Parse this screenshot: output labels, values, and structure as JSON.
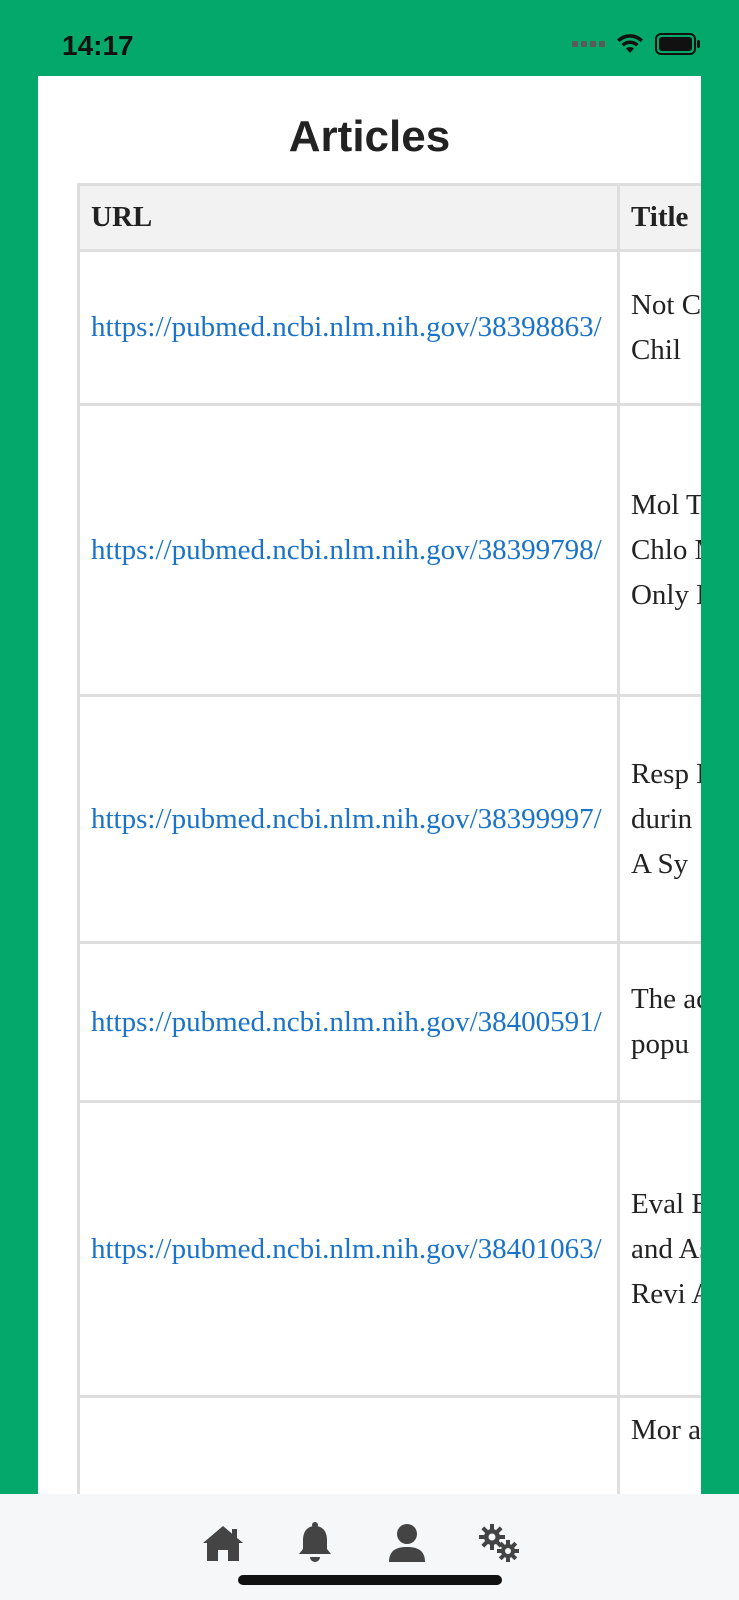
{
  "status_bar": {
    "time": "14:17",
    "icons": [
      "signal-icon",
      "wifi-icon",
      "battery-icon"
    ]
  },
  "page": {
    "title": "Articles"
  },
  "table": {
    "columns": [
      "URL",
      "Title"
    ],
    "rows": [
      {
        "url": "https://pubmed.ncbi.nlm.nih.gov/38398863/",
        "title": "Not Com Chil"
      },
      {
        "url": "https://pubmed.ncbi.nlm.nih.gov/38399798/",
        "title": "Mol Trea Chlo Mol Only Micr"
      },
      {
        "url": "https://pubmed.ncbi.nlm.nih.gov/38399997/",
        "title": "Resp Micr durin Sync A Sy"
      },
      {
        "url": "https://pubmed.ncbi.nlm.nih.gov/38400591/",
        "title": "The acute popu"
      },
      {
        "url": "https://pubmed.ncbi.nlm.nih.gov/38401063/",
        "title": "Eval Effic and Asth Revi Anal"
      },
      {
        "url": "",
        "title": "Mor addu"
      }
    ]
  },
  "tab_bar": {
    "items": [
      "home-icon",
      "bell-icon",
      "user-icon",
      "settings-icon"
    ]
  },
  "colors": {
    "background": "#05a86b",
    "link": "#1a73c9",
    "header_bg": "#f2f2f2",
    "border": "#dedede",
    "tab_icon": "#444444"
  }
}
